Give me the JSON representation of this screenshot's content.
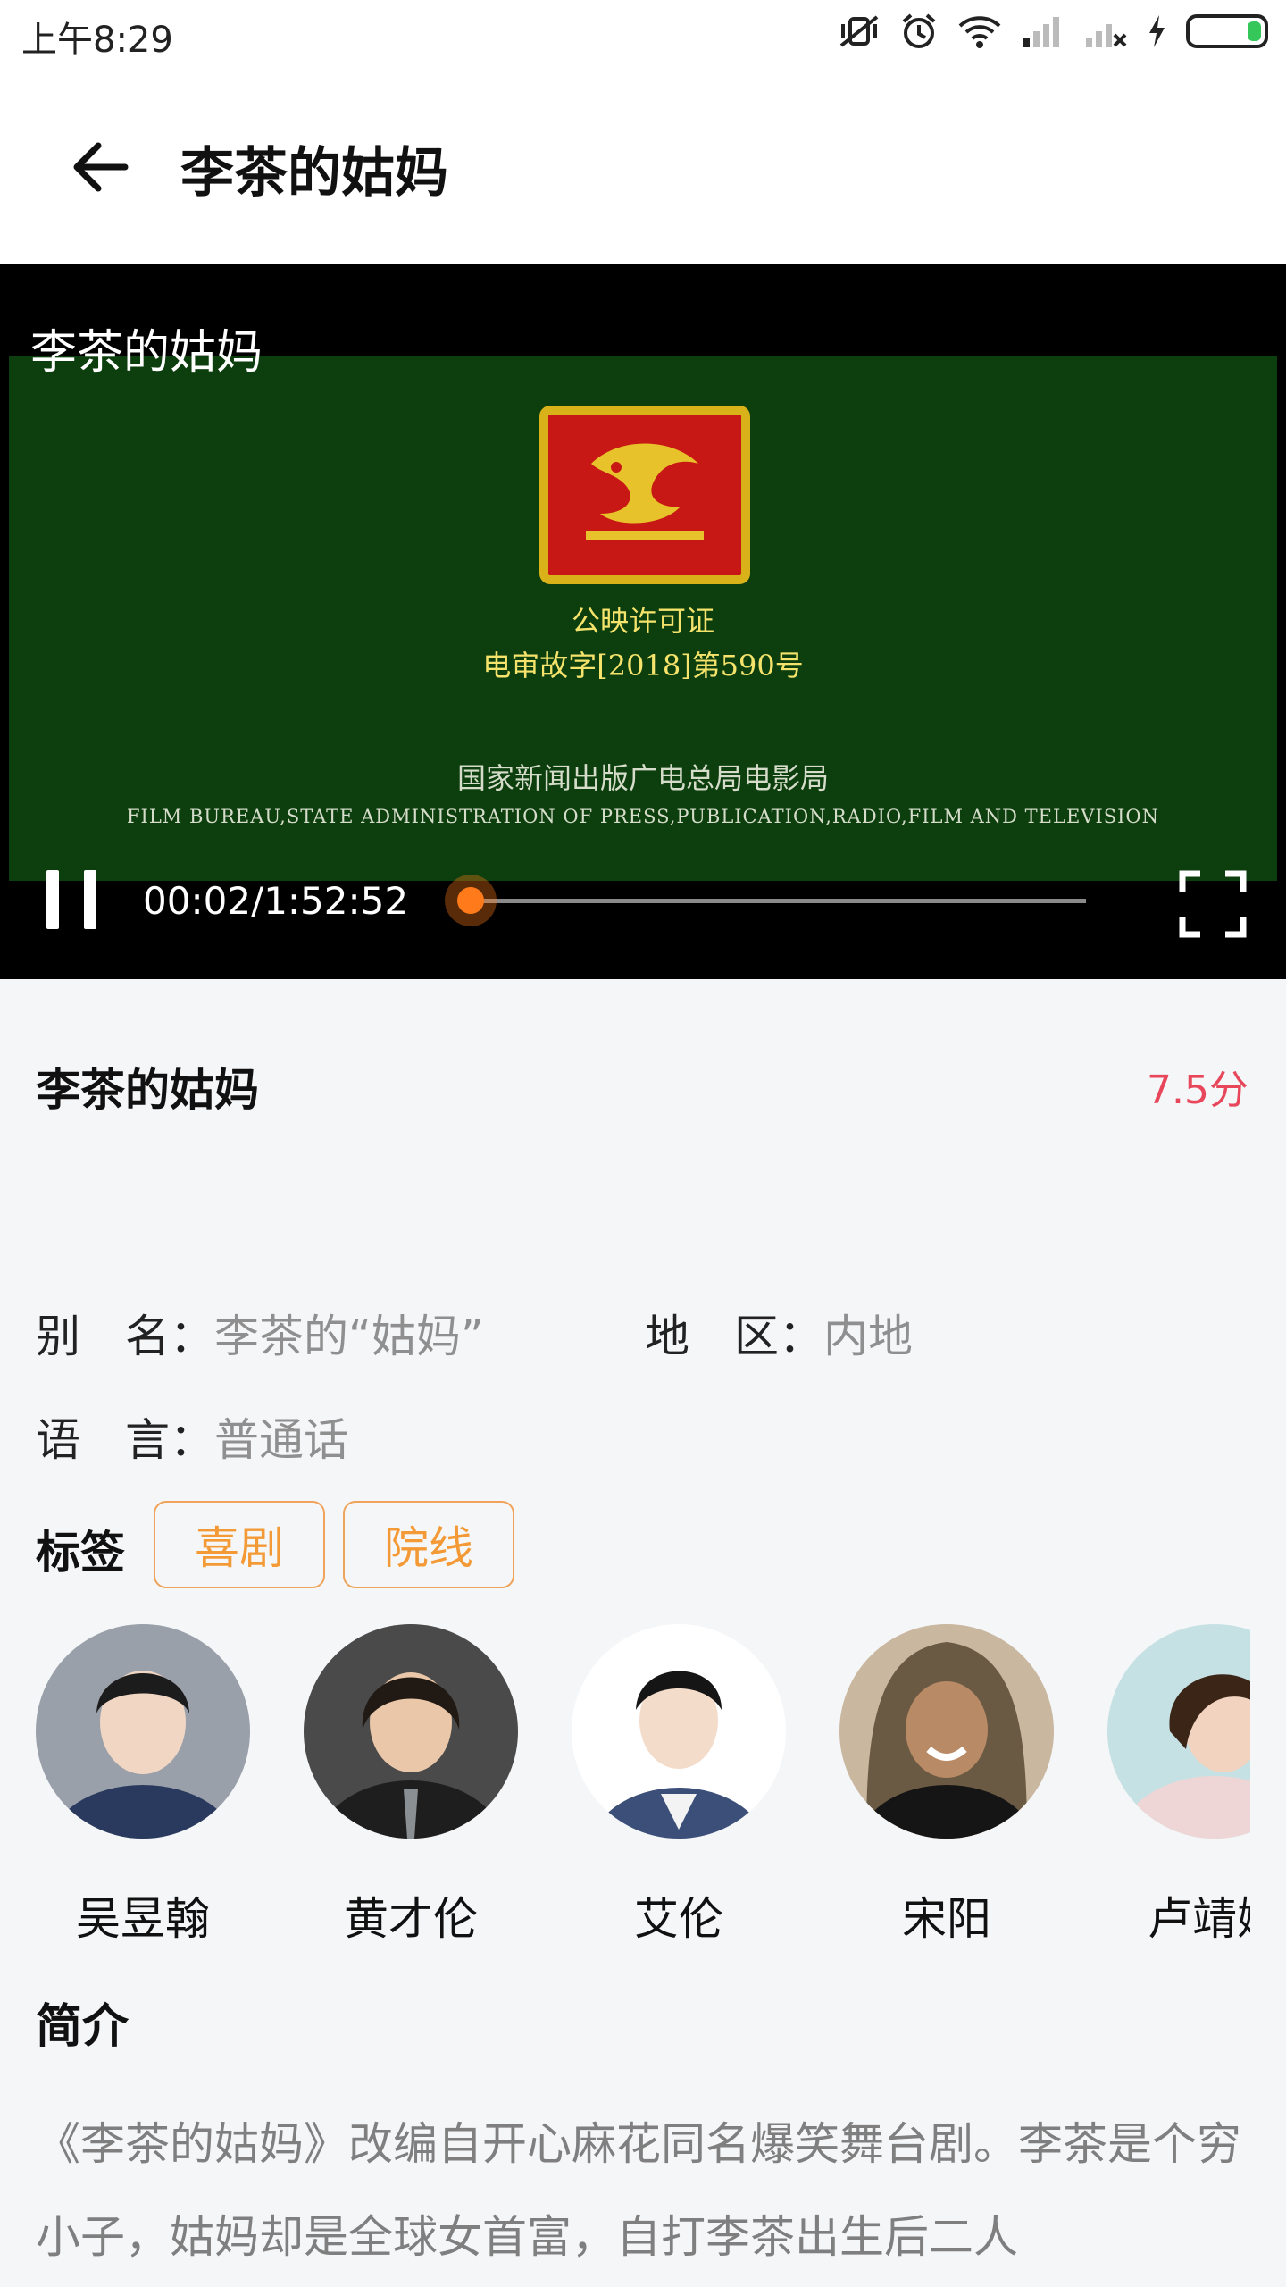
{
  "status_bar": {
    "time": "上午8:29",
    "battery_level": 0.18
  },
  "app_bar": {
    "title": "李茶的姑妈"
  },
  "video": {
    "overlay_title": "李茶的姑妈",
    "certificate": {
      "line1": "公映许可证",
      "line2": "电审故字[2018]第590号",
      "line3": "国家新闻出版广电总局电影局",
      "line4": "FILM BUREAU,STATE ADMINISTRATION OF PRESS,PUBLICATION,RADIO,FILM AND TELEVISION"
    },
    "time_display": "00:02/1:52:52",
    "progress": 0.0003
  },
  "movie": {
    "title": "李茶的姑妈",
    "rating": "7.5分",
    "alias_label": "别　名：",
    "alias_value": "李茶的“姑妈”",
    "region_label": "地　区：",
    "region_value": "内地",
    "language_label": "语　言：",
    "language_value": "普通话",
    "tags_label": "标签",
    "tags": [
      "喜剧",
      "院线"
    ],
    "cast": [
      {
        "name": "吴昱翰",
        "icon": "avatar-portrait-icon"
      },
      {
        "name": "黄才伦",
        "icon": "avatar-portrait-icon"
      },
      {
        "name": "艾伦",
        "icon": "avatar-portrait-icon"
      },
      {
        "name": "宋阳",
        "icon": "avatar-portrait-icon"
      },
      {
        "name": "卢靖姗",
        "icon": "avatar-portrait-icon"
      }
    ],
    "synopsis_title": "简介",
    "synopsis": "《李茶的姑妈》改编自开心麻花同名爆笑舞台剧。李茶是个穷小子，姑妈却是全球女首富，自打李茶出生后二人"
  },
  "colors": {
    "accent_orange": "#ff7a1a",
    "rating_red": "#e8475b",
    "tag_orange": "#f39a36"
  }
}
